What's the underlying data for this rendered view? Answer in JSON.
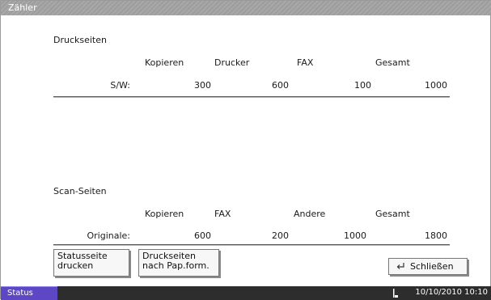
{
  "window": {
    "title": "Zähler"
  },
  "print_pages": {
    "section_title": "Druckseiten",
    "headers": [
      "Kopieren",
      "Drucker",
      "FAX",
      "Gesamt"
    ],
    "row": {
      "label": "S/W:",
      "values": [
        "300",
        "600",
        "100",
        "1000"
      ]
    }
  },
  "scan_pages": {
    "section_title": "Scan-Seiten",
    "headers": [
      "Kopieren",
      "FAX",
      "Andere",
      "Gesamt"
    ],
    "row": {
      "label": "Originale:",
      "values": [
        "600",
        "200",
        "1000",
        "1800"
      ]
    }
  },
  "buttons": {
    "status_page": {
      "line1": "Statusseite",
      "line2": "drucken"
    },
    "print_by_paper": {
      "line1": "Druckseiten",
      "line2": "nach Pap.form."
    },
    "close": {
      "label": "Schließen",
      "icon": "enter-return-icon"
    }
  },
  "statusbar": {
    "status_label": "Status",
    "datetime": "10/10/2010 10:10",
    "icon": "printer-status-icon"
  }
}
